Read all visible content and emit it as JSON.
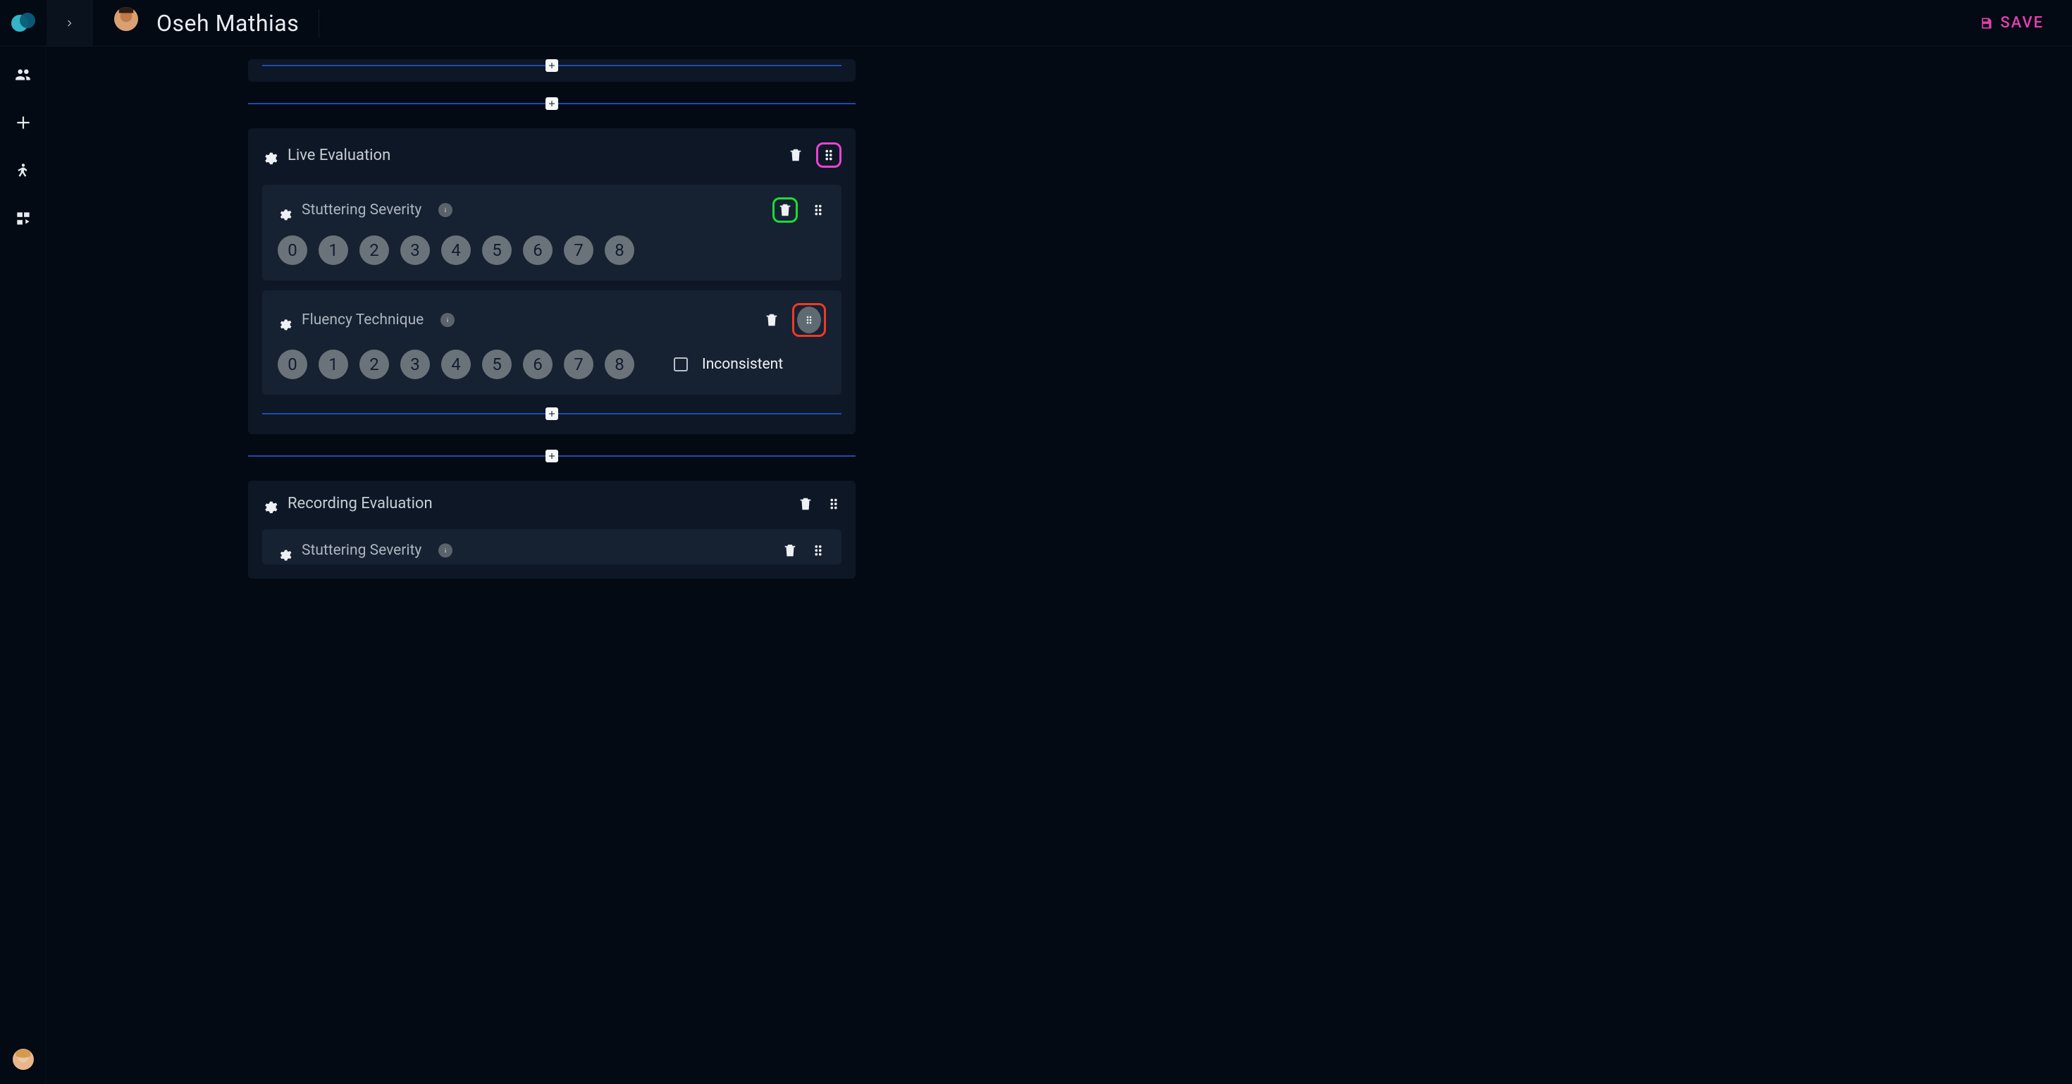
{
  "header": {
    "user_name": "Oseh Mathias",
    "save_label": "SAVE"
  },
  "highlight_colors": {
    "drag_section": "#e844d3",
    "delete_item": "#1add36",
    "drag_item": "#ef3a24"
  },
  "dividers": {
    "top_inner_add": "+",
    "between_sections_add": "+"
  },
  "sections": [
    {
      "id": "live_eval",
      "title": "Live Evaluation",
      "items": [
        {
          "id": "stutter_sev_live",
          "title": "Stuttering Severity",
          "scale": [
            "0",
            "1",
            "2",
            "3",
            "4",
            "5",
            "6",
            "7",
            "8"
          ],
          "highlight_delete": true
        },
        {
          "id": "fluency_tech",
          "title": "Fluency Technique",
          "scale": [
            "0",
            "1",
            "2",
            "3",
            "4",
            "5",
            "6",
            "7",
            "8"
          ],
          "checkbox_label": "Inconsistent",
          "highlight_drag_round": true
        }
      ]
    },
    {
      "id": "rec_eval",
      "title": "Recording Evaluation",
      "items": [
        {
          "id": "stutter_sev_rec",
          "title": "Stuttering Severity"
        }
      ]
    }
  ]
}
